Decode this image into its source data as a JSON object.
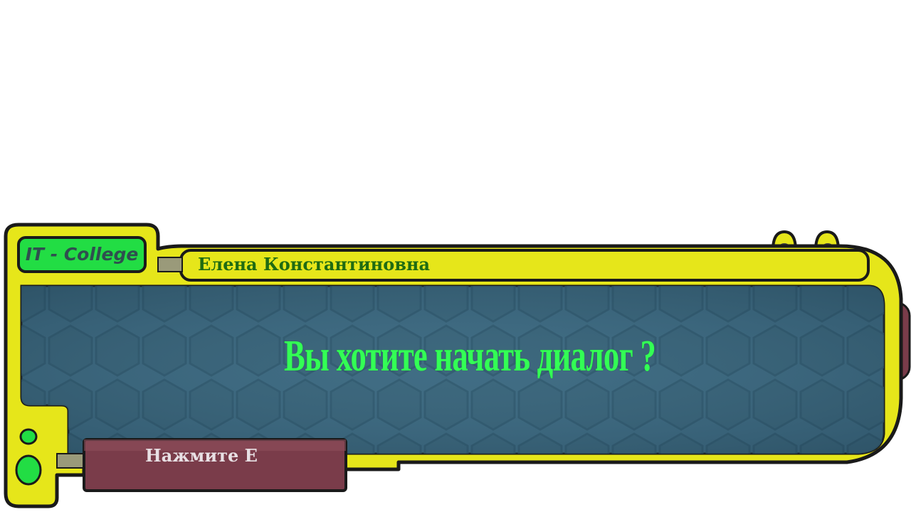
{
  "panel": {
    "college_label": "IT - College",
    "speaker_name": "Елена Константиновна",
    "question": "Вы хотите начать диалог ?",
    "press_e_label": "Нажмите E"
  },
  "colors": {
    "frame_yellow": "#e6e61a",
    "frame_outline": "#1a1a1a",
    "screen_blue": "#3f6b82",
    "question_green": "#33ff55",
    "name_green": "#1f6b12",
    "button_maroon": "#7a3c4a",
    "indicator_yellow": "#eaea6a",
    "indicator_red": "#ee1c24",
    "light_green": "#22dd44"
  }
}
